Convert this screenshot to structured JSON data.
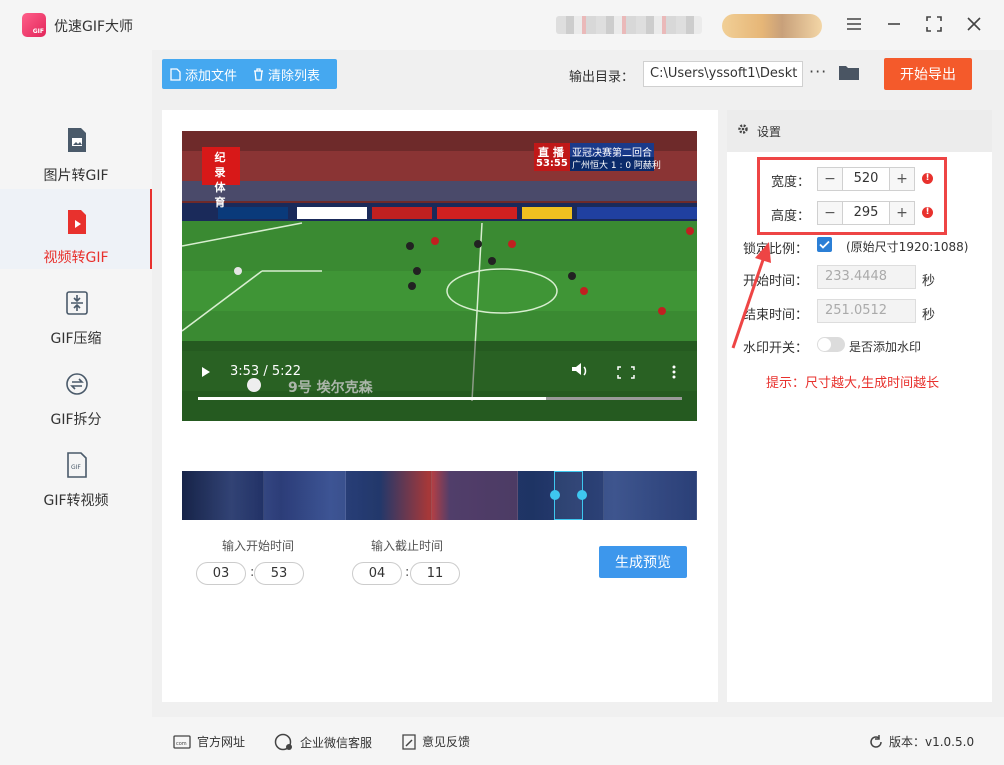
{
  "app": {
    "title": "优速GIF大师"
  },
  "sidebar": {
    "items": [
      {
        "label": "图片转GIF",
        "icon": "image-icon"
      },
      {
        "label": "视频转GIF",
        "icon": "video-file-icon",
        "active": true
      },
      {
        "label": "GIF压缩",
        "icon": "compress-icon"
      },
      {
        "label": "GIF拆分",
        "icon": "split-icon"
      },
      {
        "label": "GIF转视频",
        "icon": "gif-file-icon"
      }
    ]
  },
  "toolbar": {
    "add_file": "添加文件",
    "clear_list": "清除列表",
    "output_label": "输出目录：",
    "output_path": "C:\\Users\\yssoft1\\Deskt",
    "more": "···",
    "export": "开始导出"
  },
  "video": {
    "time": "3:53 / 5:22",
    "progress": 0.72,
    "broadcast_label": "直 播",
    "match_title": "亚冠决赛第二回合",
    "match_clock": "53:55",
    "match_score": "广州恒大 1 : 0 阿赫利",
    "channel_logo": "纪 录 体 育",
    "player_caption": "9号  埃尔克森"
  },
  "clip": {
    "start_label": "输入开始时间",
    "end_label": "输入截止时间",
    "start_min": "03",
    "start_sec": "53",
    "end_min": "04",
    "end_sec": "11",
    "sep": ":",
    "preview": "生成预览"
  },
  "settings": {
    "title": "设置",
    "width_label": "宽度：",
    "width": "520",
    "height_label": "高度：",
    "height": "295",
    "minus": "−",
    "plus": "+",
    "lock_label": "锁定比例：",
    "lock_checked": true,
    "original_size": "(原始尺寸1920:1088)",
    "start_label": "开始时间：",
    "start_value": "233.4448",
    "end_label": "结束时间：",
    "end_value": "251.0512",
    "sec": "秒",
    "watermark_label": "水印开关：",
    "watermark_on": false,
    "watermark_hint": "是否添加水印",
    "tip": "提示：尺寸越大,生成时间越长"
  },
  "footer": {
    "website": "官方网址",
    "wechat": "企业微信客服",
    "feedback": "意见反馈",
    "version": "版本：v1.0.5.0"
  },
  "colors": {
    "accent_blue": "#45a8f0",
    "export_orange": "#f45a2b",
    "active_red": "#e8312d"
  }
}
